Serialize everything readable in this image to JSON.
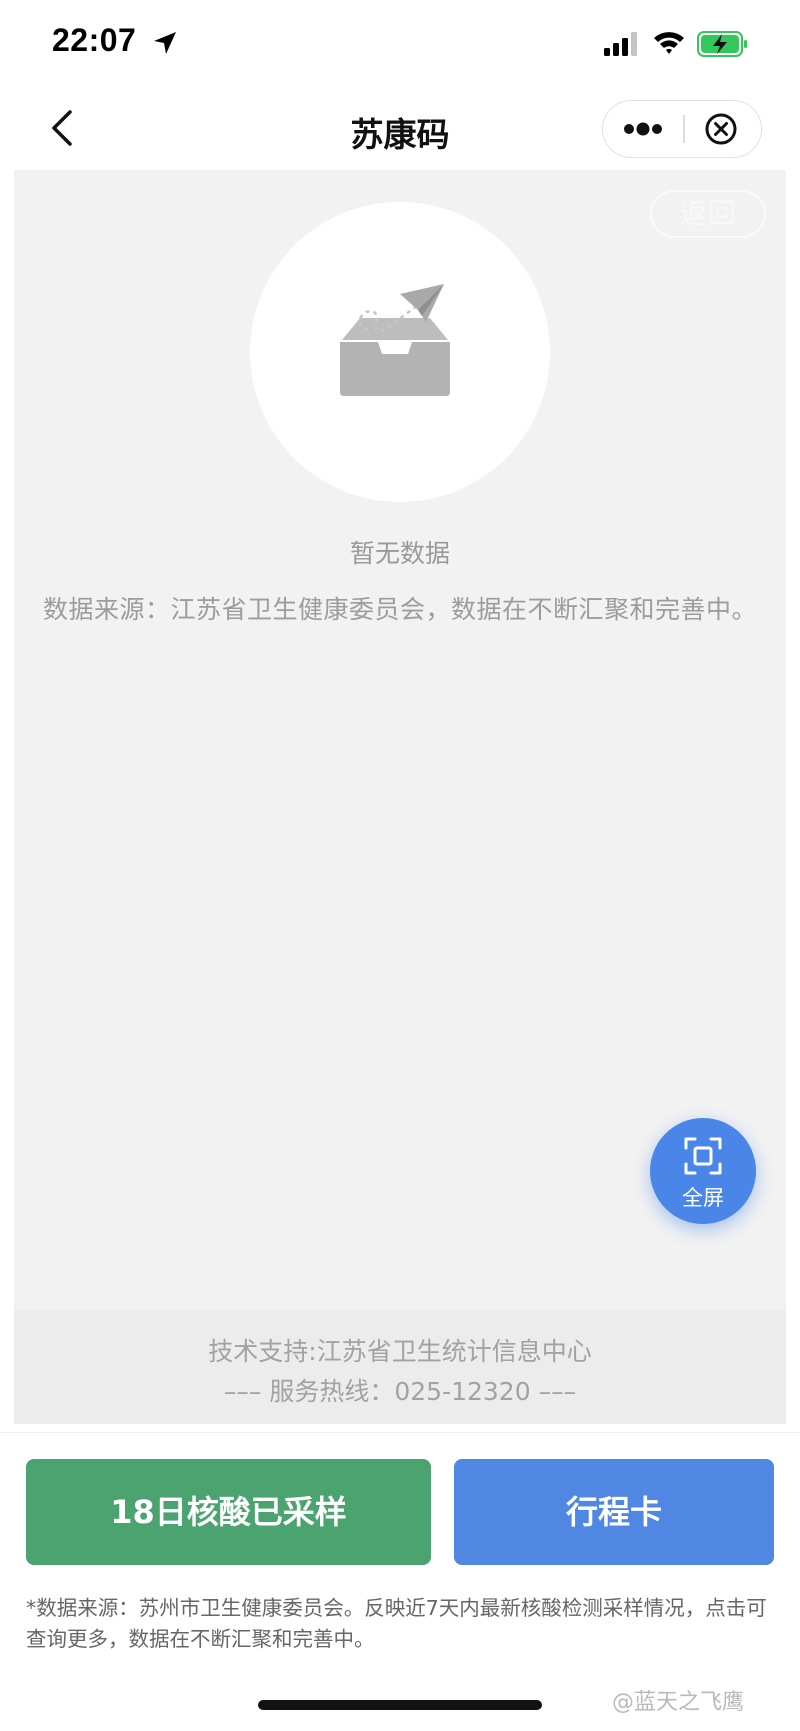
{
  "status_bar": {
    "time": "22:07",
    "icons": [
      "location-arrow-icon",
      "cellular-signal-icon",
      "wifi-icon",
      "battery-charging-icon"
    ],
    "battery_color": "#34c759"
  },
  "nav": {
    "title": "苏康码",
    "back_icon": "chevron-left-icon",
    "more_icon": "more-dots-icon",
    "close_icon": "close-circle-icon"
  },
  "content": {
    "return_label": "返回",
    "empty_icon": "empty-tray-paper-plane-icon",
    "no_data": "暂无数据",
    "source": "数据来源：江苏省卫生健康委员会，数据在不断汇聚和完善中。",
    "fullscreen_label": "全屏",
    "support": "技术支持:江苏省卫生统计信息中心",
    "hotline": "––– 服务热线：025-12320 –––"
  },
  "actions": {
    "nucleic_label": "18日核酸已采样",
    "nucleic_color": "#4ba370",
    "itinerary_label": "行程卡",
    "itinerary_color": "#4f87e2",
    "footnote": "*数据来源：苏州市卫生健康委员会。反映近7天内最新核酸检测采样情况，点击可查询更多，数据在不断汇聚和完善中。"
  },
  "watermark": "@蓝天之飞鹰"
}
